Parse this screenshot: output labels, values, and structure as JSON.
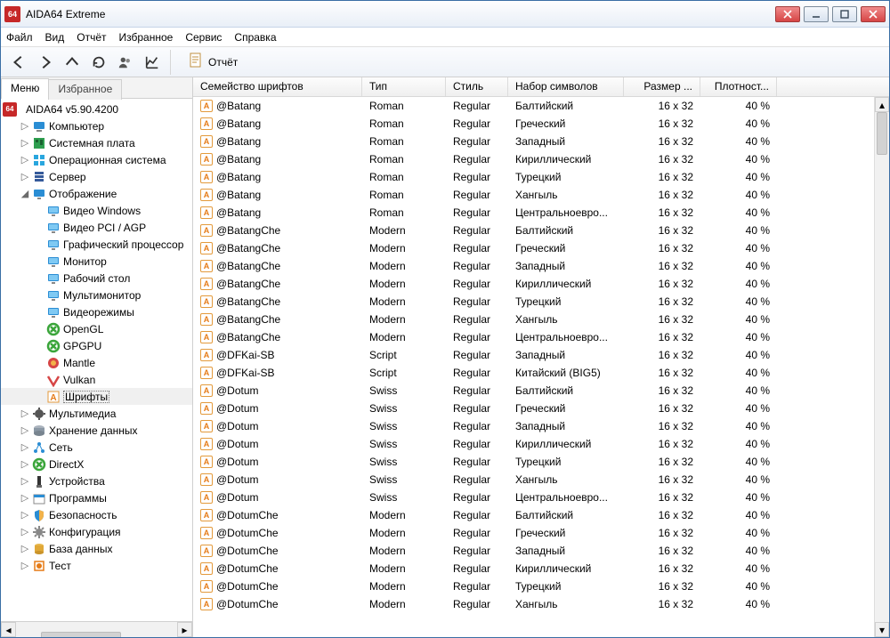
{
  "title": "AIDA64 Extreme",
  "menu": [
    "Файл",
    "Вид",
    "Отчёт",
    "Избранное",
    "Сервис",
    "Справка"
  ],
  "toolbar": {
    "report_label": "Отчёт"
  },
  "left_tabs": {
    "menu": "Меню",
    "fav": "Избранное"
  },
  "root_label": "AIDA64 v5.90.4200",
  "tree": [
    {
      "l": "Компьютер",
      "icon": "computer",
      "exp": "▷"
    },
    {
      "l": "Системная плата",
      "icon": "mb",
      "exp": "▷"
    },
    {
      "l": "Операционная система",
      "icon": "os",
      "exp": "▷"
    },
    {
      "l": "Сервер",
      "icon": "server",
      "exp": "▷"
    },
    {
      "l": "Отображение",
      "icon": "display",
      "exp": "◢",
      "children": [
        {
          "l": "Видео Windows",
          "icon": "mon"
        },
        {
          "l": "Видео PCI / AGP",
          "icon": "mon"
        },
        {
          "l": "Графический процессор",
          "icon": "mon"
        },
        {
          "l": "Монитор",
          "icon": "mon"
        },
        {
          "l": "Рабочий стол",
          "icon": "mon"
        },
        {
          "l": "Мультимонитор",
          "icon": "mon"
        },
        {
          "l": "Видеорежимы",
          "icon": "mon"
        },
        {
          "l": "OpenGL",
          "icon": "opengl"
        },
        {
          "l": "GPGPU",
          "icon": "opengl"
        },
        {
          "l": "Mantle",
          "icon": "mantle"
        },
        {
          "l": "Vulkan",
          "icon": "vulkan"
        },
        {
          "l": "Шрифты",
          "icon": "font",
          "selected": true
        }
      ]
    },
    {
      "l": "Мультимедиа",
      "icon": "mm",
      "exp": "▷"
    },
    {
      "l": "Хранение данных",
      "icon": "hdd",
      "exp": "▷"
    },
    {
      "l": "Сеть",
      "icon": "net",
      "exp": "▷"
    },
    {
      "l": "DirectX",
      "icon": "dx",
      "exp": "▷"
    },
    {
      "l": "Устройства",
      "icon": "dev",
      "exp": "▷"
    },
    {
      "l": "Программы",
      "icon": "prog",
      "exp": "▷"
    },
    {
      "l": "Безопасность",
      "icon": "sec",
      "exp": "▷"
    },
    {
      "l": "Конфигурация",
      "icon": "conf",
      "exp": "▷"
    },
    {
      "l": "База данных",
      "icon": "db",
      "exp": "▷"
    },
    {
      "l": "Тест",
      "icon": "test",
      "exp": "▷"
    }
  ],
  "grid": {
    "headers": [
      "Семейство шрифтов",
      "Тип",
      "Стиль",
      "Набор символов",
      "Размер ...",
      "Плотност..."
    ],
    "rows": [
      {
        "n": "@Batang",
        "t": "Roman",
        "s": "Regular",
        "c": "Балтийский",
        "sz": "16 x 32",
        "d": "40 %"
      },
      {
        "n": "@Batang",
        "t": "Roman",
        "s": "Regular",
        "c": "Греческий",
        "sz": "16 x 32",
        "d": "40 %"
      },
      {
        "n": "@Batang",
        "t": "Roman",
        "s": "Regular",
        "c": "Западный",
        "sz": "16 x 32",
        "d": "40 %"
      },
      {
        "n": "@Batang",
        "t": "Roman",
        "s": "Regular",
        "c": "Кириллический",
        "sz": "16 x 32",
        "d": "40 %"
      },
      {
        "n": "@Batang",
        "t": "Roman",
        "s": "Regular",
        "c": "Турецкий",
        "sz": "16 x 32",
        "d": "40 %"
      },
      {
        "n": "@Batang",
        "t": "Roman",
        "s": "Regular",
        "c": "Хангыль",
        "sz": "16 x 32",
        "d": "40 %"
      },
      {
        "n": "@Batang",
        "t": "Roman",
        "s": "Regular",
        "c": "Центральноевро...",
        "sz": "16 x 32",
        "d": "40 %"
      },
      {
        "n": "@BatangChe",
        "t": "Modern",
        "s": "Regular",
        "c": "Балтийский",
        "sz": "16 x 32",
        "d": "40 %"
      },
      {
        "n": "@BatangChe",
        "t": "Modern",
        "s": "Regular",
        "c": "Греческий",
        "sz": "16 x 32",
        "d": "40 %"
      },
      {
        "n": "@BatangChe",
        "t": "Modern",
        "s": "Regular",
        "c": "Западный",
        "sz": "16 x 32",
        "d": "40 %"
      },
      {
        "n": "@BatangChe",
        "t": "Modern",
        "s": "Regular",
        "c": "Кириллический",
        "sz": "16 x 32",
        "d": "40 %"
      },
      {
        "n": "@BatangChe",
        "t": "Modern",
        "s": "Regular",
        "c": "Турецкий",
        "sz": "16 x 32",
        "d": "40 %"
      },
      {
        "n": "@BatangChe",
        "t": "Modern",
        "s": "Regular",
        "c": "Хангыль",
        "sz": "16 x 32",
        "d": "40 %"
      },
      {
        "n": "@BatangChe",
        "t": "Modern",
        "s": "Regular",
        "c": "Центральноевро...",
        "sz": "16 x 32",
        "d": "40 %"
      },
      {
        "n": "@DFKai-SB",
        "t": "Script",
        "s": "Regular",
        "c": "Западный",
        "sz": "16 x 32",
        "d": "40 %"
      },
      {
        "n": "@DFKai-SB",
        "t": "Script",
        "s": "Regular",
        "c": "Китайский (BIG5)",
        "sz": "16 x 32",
        "d": "40 %"
      },
      {
        "n": "@Dotum",
        "t": "Swiss",
        "s": "Regular",
        "c": "Балтийский",
        "sz": "16 x 32",
        "d": "40 %"
      },
      {
        "n": "@Dotum",
        "t": "Swiss",
        "s": "Regular",
        "c": "Греческий",
        "sz": "16 x 32",
        "d": "40 %"
      },
      {
        "n": "@Dotum",
        "t": "Swiss",
        "s": "Regular",
        "c": "Западный",
        "sz": "16 x 32",
        "d": "40 %"
      },
      {
        "n": "@Dotum",
        "t": "Swiss",
        "s": "Regular",
        "c": "Кириллический",
        "sz": "16 x 32",
        "d": "40 %"
      },
      {
        "n": "@Dotum",
        "t": "Swiss",
        "s": "Regular",
        "c": "Турецкий",
        "sz": "16 x 32",
        "d": "40 %"
      },
      {
        "n": "@Dotum",
        "t": "Swiss",
        "s": "Regular",
        "c": "Хангыль",
        "sz": "16 x 32",
        "d": "40 %"
      },
      {
        "n": "@Dotum",
        "t": "Swiss",
        "s": "Regular",
        "c": "Центральноевро...",
        "sz": "16 x 32",
        "d": "40 %"
      },
      {
        "n": "@DotumChe",
        "t": "Modern",
        "s": "Regular",
        "c": "Балтийский",
        "sz": "16 x 32",
        "d": "40 %"
      },
      {
        "n": "@DotumChe",
        "t": "Modern",
        "s": "Regular",
        "c": "Греческий",
        "sz": "16 x 32",
        "d": "40 %"
      },
      {
        "n": "@DotumChe",
        "t": "Modern",
        "s": "Regular",
        "c": "Западный",
        "sz": "16 x 32",
        "d": "40 %"
      },
      {
        "n": "@DotumChe",
        "t": "Modern",
        "s": "Regular",
        "c": "Кириллический",
        "sz": "16 x 32",
        "d": "40 %"
      },
      {
        "n": "@DotumChe",
        "t": "Modern",
        "s": "Regular",
        "c": "Турецкий",
        "sz": "16 x 32",
        "d": "40 %"
      },
      {
        "n": "@DotumChe",
        "t": "Modern",
        "s": "Regular",
        "c": "Хангыль",
        "sz": "16 x 32",
        "d": "40 %"
      }
    ]
  }
}
